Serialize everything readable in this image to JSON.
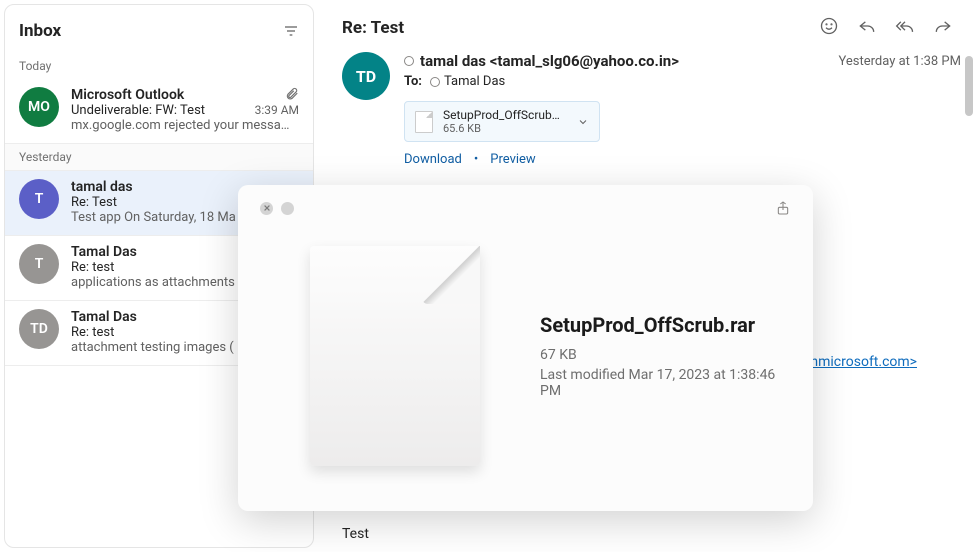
{
  "sidebar": {
    "title": "Inbox",
    "sections": [
      {
        "label": "Today"
      },
      {
        "label": "Yesterday"
      }
    ]
  },
  "messages": [
    {
      "avatarText": "MO",
      "avatarColor": "#107c41",
      "from": "Microsoft Outlook",
      "subject": "Undeliverable: FW: Test",
      "preview": "mx.google.com rejected your messa…",
      "time": "3:39 AM",
      "hasAttachment": true,
      "section": 0
    },
    {
      "avatarText": "T",
      "avatarColor": "#5b5fc7",
      "from": "tamal das",
      "subject": "Re: Test",
      "preview": "Test app On Saturday, 18 Ma",
      "time": "",
      "hasAttachment": false,
      "selected": true,
      "section": 1
    },
    {
      "avatarText": "T",
      "avatarColor": "#979593",
      "from": "Tamal Das",
      "subject": "Re: test",
      "preview": "applications as attachments",
      "time": "",
      "hasAttachment": false,
      "section": 1
    },
    {
      "avatarText": "TD",
      "avatarColor": "#979593",
      "from": "Tamal Das",
      "subject": "Re: test",
      "preview": "attachment testing images (",
      "time": "",
      "hasAttachment": false,
      "section": 1
    }
  ],
  "reader": {
    "subject": "Re: Test",
    "date": "Yesterday at 1:38 PM",
    "fromDisplay": "tamal das <tamal_slg06@yahoo.co.in>",
    "avatarText": "TD",
    "toLabel": "To:",
    "toName": "Tamal Das",
    "attachment": {
      "name": "SetupProd_OffScrub…",
      "size": "65.6 KB"
    },
    "downloadLabel": "Download",
    "previewLabel": "Preview",
    "bodyText": "Test",
    "linkFragment": ".onmicrosoft.com"
  },
  "quicklook": {
    "filename": "SetupProd_OffScrub.rar",
    "size": "67 KB",
    "modified": "Last modified Mar 17, 2023 at 1:38:46 PM"
  }
}
